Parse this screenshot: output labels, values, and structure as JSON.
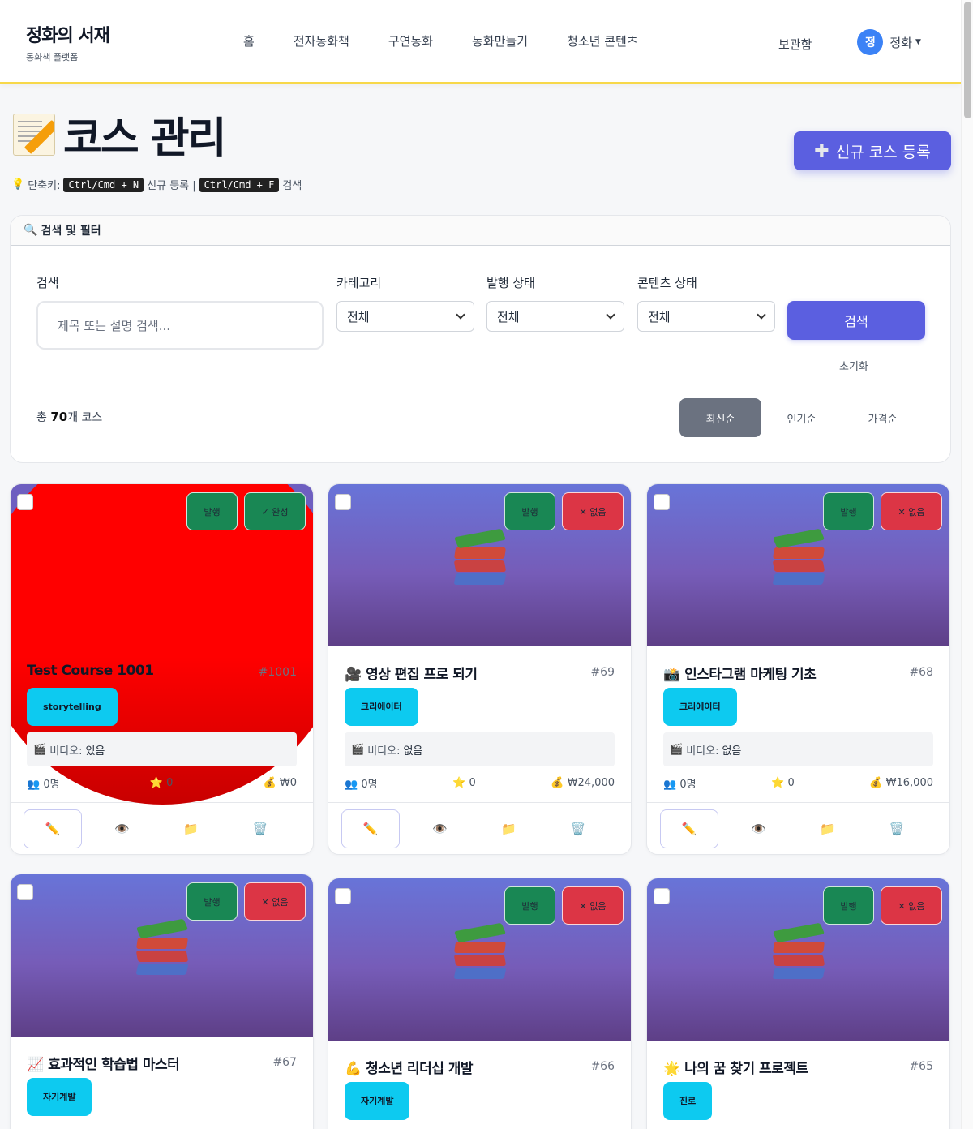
{
  "brand": {
    "title": "정화의 서재",
    "subtitle": "동화책 플랫폼"
  },
  "nav": {
    "items": [
      "홈",
      "전자동화책",
      "구연동화",
      "동화만들기",
      "청소년 콘텐츠"
    ],
    "archive": "보관함",
    "avatar_letter": "정",
    "user_name": "정화"
  },
  "header": {
    "title": "코스 관리",
    "title_icon": "memo-icon",
    "new_button": "신규 코스 등록",
    "new_button_icon": "plus-icon",
    "shortcut_label": "단축키:",
    "shortcut_new_key": "Ctrl/Cmd + N",
    "shortcut_new_text": "신규 등록 |",
    "shortcut_search_key": "Ctrl/Cmd + F",
    "shortcut_search_text": "검색"
  },
  "filter": {
    "heading": "검색 및 필터",
    "search_label": "검색",
    "search_placeholder": "제목 또는 설명 검색...",
    "category_label": "카테고리",
    "category_value": "전체",
    "publish_label": "발행 상태",
    "publish_value": "전체",
    "content_label": "콘텐츠 상태",
    "content_value": "전체",
    "search_button": "검색",
    "reset_button": "초기화",
    "total_prefix": "총",
    "total_count": "70",
    "total_suffix": "개 코스",
    "sort": [
      "최신순",
      "인기순",
      "가격순"
    ],
    "sort_active": "최신순"
  },
  "courses": [
    {
      "title": "Test Course 1001",
      "id": "#1001",
      "category": "storytelling",
      "publish": "발행",
      "content_status": "✓ 완성",
      "video_label": "비디오:",
      "video": "있음",
      "students": "0명",
      "rating": "0",
      "price": "₩0",
      "thumb": "red-circle"
    },
    {
      "title": "🎥 영상 편집 프로 되기",
      "id": "#69",
      "category": "크리에이터",
      "publish": "발행",
      "content_status": "✕ 없음",
      "video_label": "비디오:",
      "video": "없음",
      "students": "0명",
      "rating": "0",
      "price": "₩24,000",
      "thumb": "books"
    },
    {
      "title": "📸 인스타그램 마케팅 기초",
      "id": "#68",
      "category": "크리에이터",
      "publish": "발행",
      "content_status": "✕ 없음",
      "video_label": "비디오:",
      "video": "없음",
      "students": "0명",
      "rating": "0",
      "price": "₩16,000",
      "thumb": "books"
    },
    {
      "title": "📈 효과적인 학습법 마스터",
      "id": "#67",
      "category": "자기계발",
      "publish": "발행",
      "content_status": "✕ 없음",
      "thumb": "books"
    },
    {
      "title": "💪 청소년 리더십 개발",
      "id": "#66",
      "category": "자기계발",
      "publish": "발행",
      "content_status": "✕ 없음",
      "thumb": "books"
    },
    {
      "title": "🌟 나의 꿈 찾기 프로젝트",
      "id": "#65",
      "category": "진로",
      "publish": "발행",
      "content_status": "✕ 없음",
      "thumb": "books"
    }
  ],
  "icons": {
    "students": "people-icon",
    "rating": "star-icon",
    "price": "money-bag-icon",
    "video": "clapper-icon",
    "actions": [
      "pencil-icon",
      "eye-icon",
      "folder-icon",
      "trash-icon"
    ]
  },
  "colors": {
    "primary": "#5b5fe0",
    "success": "#198754",
    "danger": "#dc3545",
    "info": "#0dcaf0",
    "nav_accent": "#f7d84a"
  }
}
